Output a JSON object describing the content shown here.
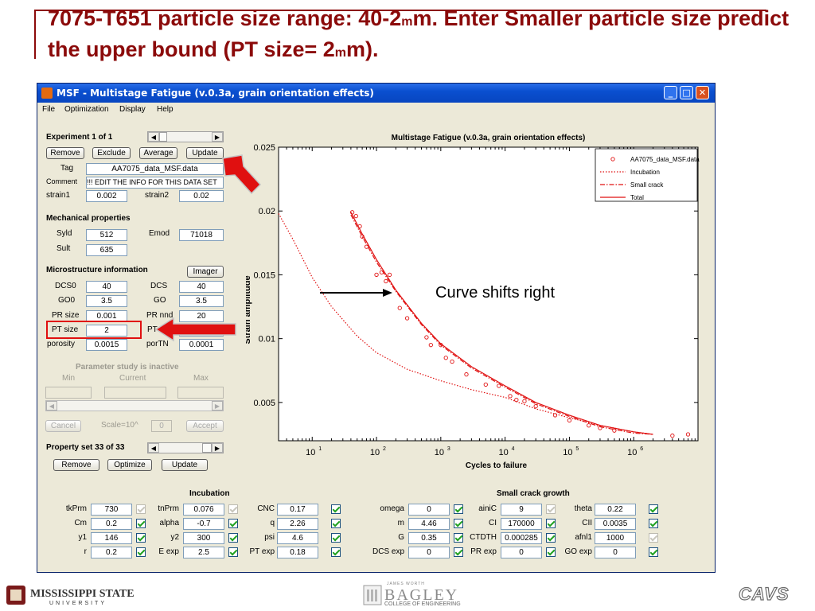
{
  "slide": {
    "title_pre": "7075-T651 particle size range: 40-2",
    "title_unit1": "m",
    "title_mid": "m.  Enter Smaller particle size predict the upper bound  (PT size= 2",
    "title_unit2": "m",
    "title_post": "m)."
  },
  "window": {
    "title": "MSF - Multistage Fatigue (v.0.3a, grain orientation effects)",
    "min_icon": "minimize-icon",
    "max_icon": "maximize-icon",
    "close_icon": "close-icon"
  },
  "menu": [
    "File",
    "Optimization",
    "Display",
    "Help"
  ],
  "experiment": {
    "label": "Experiment 1 of 1",
    "remove": "Remove",
    "exclude": "Exclude",
    "average": "Average",
    "update": "Update",
    "tag_label": "Tag",
    "tag_value": "AA7075_data_MSF.data",
    "comment_label": "Comment",
    "comment_value": "!!! EDIT THE INFO FOR THIS DATA SET",
    "strain1_label": "strain1",
    "strain1_value": "0.002",
    "strain2_label": "strain2",
    "strain2_value": "0.02"
  },
  "mech": {
    "header": "Mechanical properties",
    "syld_label": "Syld",
    "syld_value": "512",
    "emod_label": "Emod",
    "emod_value": "71018",
    "sult_label": "Sult",
    "sult_value": "635"
  },
  "micro": {
    "header": "Microstructure information",
    "imager": "Imager",
    "dcs0_label": "DCS0",
    "dcs0_value": "40",
    "dcs_label": "DCS",
    "dcs_value": "40",
    "go0_label": "GO0",
    "go0_value": "3.5",
    "go_label": "GO",
    "go_value": "3.5",
    "prsize_label": "PR size",
    "prsize_value": "0.001",
    "prnnd_label": "PR nnd",
    "prnnd_value": "20",
    "ptsize_label": "PT size",
    "ptsize_value": "2",
    "ptnnd_label": "PT nnd",
    "porosity_label": "porosity",
    "porosity_value": "0.0015",
    "por_label": "porTN",
    "por_value": "0.0001"
  },
  "param": {
    "header": "Parameter study is inactive",
    "min": "Min",
    "current": "Current",
    "max": "Max",
    "cancel": "Cancel",
    "scale": "Scale=10^",
    "scale_value": "0",
    "accept": "Accept"
  },
  "propset": {
    "label": "Property set 33 of 33",
    "remove": "Remove",
    "optimize": "Optimize",
    "update": "Update"
  },
  "incubation": {
    "header": "Incubation",
    "rows": [
      {
        "l1": "tkPrm",
        "v1": "730",
        "c1": false,
        "l2": "tnPrm",
        "v2": "0.076",
        "c2": false,
        "l3": "CNC",
        "v3": "0.17",
        "c3": true
      },
      {
        "l1": "Cm",
        "v1": "0.2",
        "c1": true,
        "l2": "alpha",
        "v2": "-0.7",
        "c2": true,
        "l3": "q",
        "v3": "2.26",
        "c3": true
      },
      {
        "l1": "y1",
        "v1": "146",
        "c1": true,
        "l2": "y2",
        "v2": "300",
        "c2": true,
        "l3": "psi",
        "v3": "4.6",
        "c3": true
      },
      {
        "l1": "r",
        "v1": "0.2",
        "c1": true,
        "l2": "E exp",
        "v2": "2.5",
        "c2": true,
        "l3": "PT exp",
        "v3": "0.18",
        "c3": true
      }
    ]
  },
  "smallcrack": {
    "header": "Small crack growth",
    "rows": [
      {
        "l1": "omega",
        "v1": "0",
        "c1": true,
        "l2": "ainiC",
        "v2": "9",
        "c2": false,
        "l3": "theta",
        "v3": "0.22",
        "c3": true
      },
      {
        "l1": "m",
        "v1": "4.46",
        "c1": true,
        "l2": "CI",
        "v2": "170000",
        "c2": true,
        "l3": "CII",
        "v3": "0.0035",
        "c3": true
      },
      {
        "l1": "G",
        "v1": "0.35",
        "c1": true,
        "l2": "CTDTH",
        "v2": "0.000285",
        "c2": true,
        "l3": "afnl1",
        "v3": "1000",
        "c3": false
      },
      {
        "l1": "DCS exp",
        "v1": "0",
        "c1": true,
        "l2": "PR exp",
        "v2": "0",
        "c2": true,
        "l3": "GO exp",
        "v3": "0",
        "c3": true
      }
    ]
  },
  "annotation": "Curve shifts right",
  "footer": {
    "msu1": "MISSISSIPPI STATE",
    "msu2": "UNIVERSITY",
    "bagley_top": "JAMES WORTH",
    "bagley": "BAGLEY",
    "bagley_sub": "COLLEGE OF ENGINEERING",
    "cavs": "CAVS"
  },
  "colors": {
    "title": "#8b0a0a",
    "curve": "#e01010",
    "arrow": "#e01010"
  },
  "chart_data": {
    "type": "scatter",
    "title": "Multistage Fatigue (v.0.3a, grain orientation effects)",
    "xlabel": "Cycles to failure",
    "ylabel": "Strain amplitude",
    "xscale": "log",
    "xlim": [
      3,
      10000000
    ],
    "ylim": [
      0.002,
      0.025
    ],
    "x_ticks": [
      "10",
      "10",
      "10",
      "10",
      "10",
      "10"
    ],
    "x_tick_exp": [
      "1",
      "2",
      "3",
      "4",
      "5",
      "6"
    ],
    "y_ticks": [
      "0.025",
      "0.02",
      "0.015",
      "0.01",
      "0.005"
    ],
    "y_tick_values": [
      0.025,
      0.02,
      0.015,
      0.01,
      0.005
    ],
    "legend_position": "top-right",
    "series": [
      {
        "name": "AA7075_data_MSF.data",
        "style": "markers",
        "x": [
          42,
          48,
          55,
          60,
          70,
          100,
          120,
          140,
          160,
          230,
          300,
          600,
          700,
          1000,
          1200,
          1500,
          2500,
          5000,
          8000,
          12000,
          15000,
          20000,
          30000,
          60000,
          100000,
          200000,
          300000,
          500000,
          4000000,
          7000000
        ],
        "y": [
          0.0199,
          0.0196,
          0.0188,
          0.018,
          0.0172,
          0.015,
          0.0152,
          0.0145,
          0.015,
          0.0124,
          0.0116,
          0.0101,
          0.0095,
          0.0095,
          0.0085,
          0.0082,
          0.0072,
          0.0064,
          0.0063,
          0.0055,
          0.0052,
          0.0051,
          0.0047,
          0.004,
          0.0036,
          0.0032,
          0.003,
          0.0028,
          0.0024,
          0.0025
        ]
      },
      {
        "name": "Incubation",
        "style": "dotted",
        "x": [
          3,
          5,
          10,
          20,
          50,
          100,
          300,
          1000,
          3000,
          10000,
          30000,
          100000,
          300000,
          1000000,
          2000000
        ],
        "y": [
          0.0198,
          0.0178,
          0.0148,
          0.0125,
          0.0102,
          0.0089,
          0.0076,
          0.0067,
          0.006,
          0.0054,
          0.0045,
          0.0038,
          0.0032,
          0.0027,
          0.0025
        ]
      },
      {
        "name": "Small crack",
        "style": "dashdot",
        "x": [
          40,
          60,
          100,
          200,
          500,
          1000,
          3000,
          10000,
          30000,
          100000,
          300000,
          1000000,
          2000000
        ],
        "y": [
          0.0197,
          0.018,
          0.016,
          0.0137,
          0.0111,
          0.0095,
          0.0077,
          0.0062,
          0.0049,
          0.0039,
          0.0031,
          0.0026,
          0.0025
        ]
      },
      {
        "name": "Total",
        "style": "solid",
        "x": [
          40,
          60,
          100,
          200,
          500,
          1000,
          3000,
          10000,
          30000,
          100000,
          300000,
          1000000,
          2000000
        ],
        "y": [
          0.0199,
          0.0182,
          0.0162,
          0.0138,
          0.0112,
          0.0096,
          0.0078,
          0.0063,
          0.005,
          0.004,
          0.0032,
          0.0027,
          0.0025
        ]
      }
    ]
  }
}
